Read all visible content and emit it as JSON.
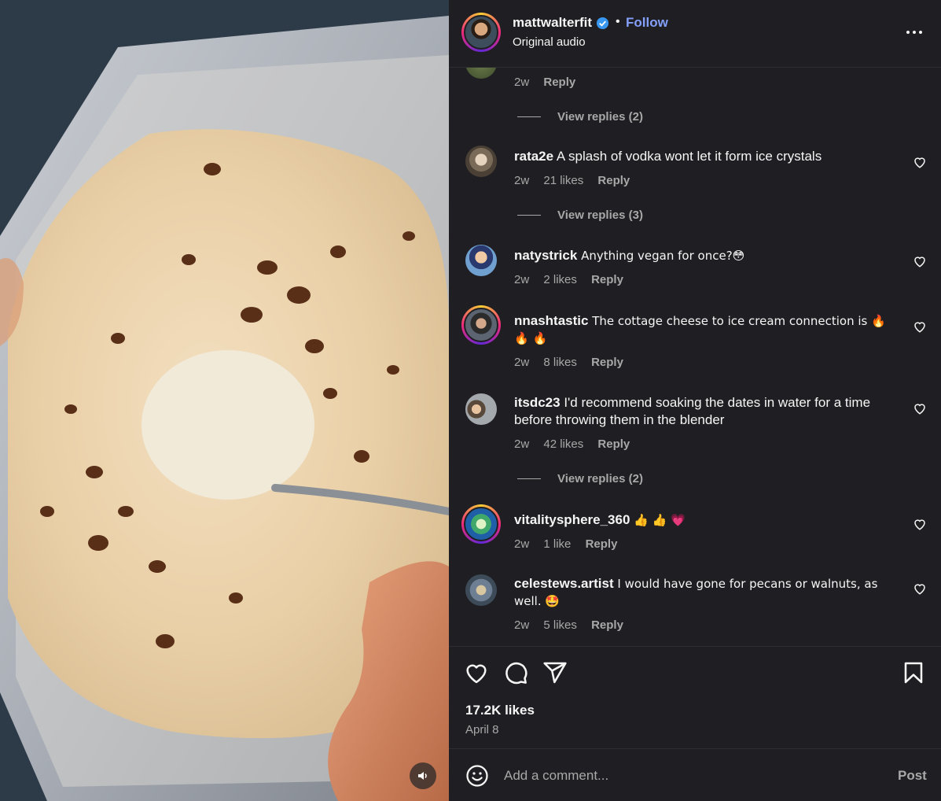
{
  "header": {
    "username": "mattwalterfit",
    "verified": true,
    "separator": "•",
    "follow_label": "Follow",
    "subtitle": "Original audio"
  },
  "partial_comment": {
    "age": "2w",
    "reply_label": "Reply",
    "view_replies": "View replies (2)"
  },
  "comments": [
    {
      "username": "rata2e",
      "text": "A splash of vodka wont let it form ice crystals",
      "age": "2w",
      "likes": "21 likes",
      "reply_label": "Reply",
      "view_replies": "View replies (3)"
    },
    {
      "username": "natystrick",
      "text": "Anything vegan for once?😳",
      "age": "2w",
      "likes": "2 likes",
      "reply_label": "Reply"
    },
    {
      "username": "nnashtastic",
      "text": "The cottage cheese to ice cream connection is 🔥 🔥 🔥",
      "age": "2w",
      "likes": "8 likes",
      "reply_label": "Reply"
    },
    {
      "username": "itsdc23",
      "text": "I'd recommend soaking the dates in water for a time before throwing them in the blender",
      "age": "2w",
      "likes": "42 likes",
      "reply_label": "Reply",
      "view_replies": "View replies (2)"
    },
    {
      "username": "vitalitysphere_360",
      "text": "👍 👍 💗",
      "age": "2w",
      "likes": "1 like",
      "reply_label": "Reply"
    },
    {
      "username": "celestews.artist",
      "text": "I would have gone for pecans or walnuts, as well. 🤩",
      "age": "2w",
      "likes": "5 likes",
      "reply_label": "Reply"
    }
  ],
  "actions": {
    "icons": [
      "heart-icon",
      "comment-icon",
      "share-icon",
      "bookmark-icon"
    ],
    "likes": "17.2K likes",
    "date": "April 8"
  },
  "composer": {
    "placeholder": "Add a comment...",
    "post_label": "Post",
    "emoji_icon": "emoji-icon"
  },
  "colors": {
    "panel_bg": "#1f1f23",
    "link_blue": "#849ffa",
    "muted_text": "#a8a8a8",
    "verified_blue": "#3897f0"
  }
}
